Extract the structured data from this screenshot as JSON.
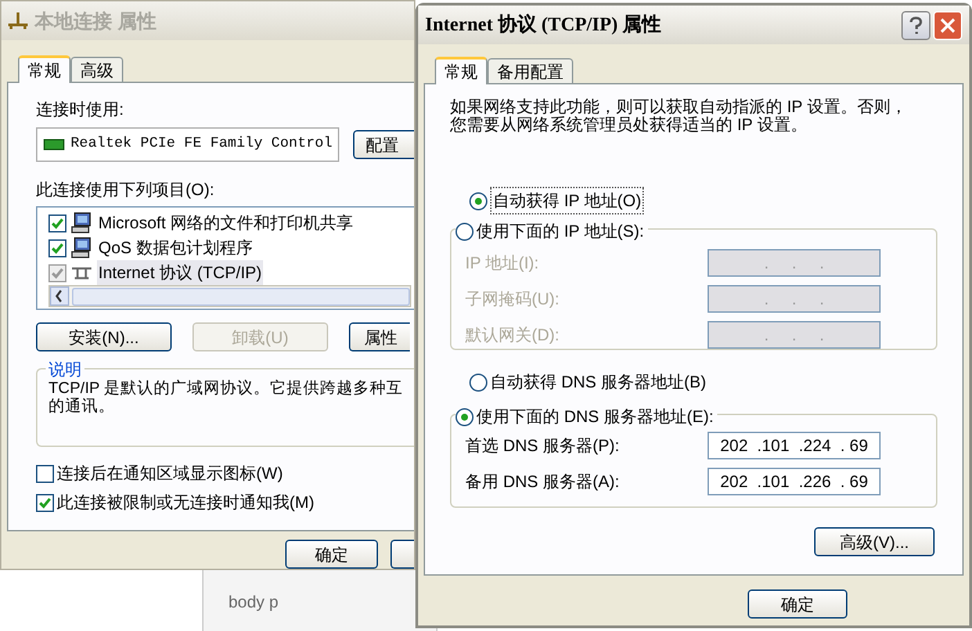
{
  "left_window": {
    "title": "本地连接 属性",
    "tabs": [
      {
        "label": "常规",
        "selected": true
      },
      {
        "label": "高级",
        "selected": false
      }
    ],
    "connect_using_label": "连接时使用:",
    "adapter": "Realtek PCIe FE Family Control",
    "configure_button": "配置",
    "components_label": "此连接使用下列项目(O):",
    "components": [
      {
        "label": "Microsoft 网络的文件和打印机共享",
        "checked": true,
        "selected": false,
        "kind": "computer"
      },
      {
        "label": "QoS 数据包计划程序",
        "checked": true,
        "selected": false,
        "kind": "computer"
      },
      {
        "label": "Internet 协议 (TCP/IP)",
        "checked": true,
        "selected": true,
        "kind": "network"
      }
    ],
    "buttons": [
      {
        "label": "安装(N)...",
        "disabled": false
      },
      {
        "label": "卸载(U)",
        "disabled": true
      },
      {
        "label": "属性",
        "disabled": false
      }
    ],
    "description_title": "说明",
    "description_lines": [
      "TCP/IP 是默认的广域网协议。它提供跨越多种互",
      "的通讯。"
    ],
    "options": [
      {
        "label": "连接后在通知区域显示图标(W)",
        "checked": false
      },
      {
        "label": "此连接被限制或无连接时通知我(M)",
        "checked": true
      }
    ],
    "footer_buttons": [
      "确定"
    ]
  },
  "background_window": {
    "text": "body p"
  },
  "right_window": {
    "title": "Internet 协议 (TCP/IP) 属性",
    "tabs": [
      {
        "label": "常规",
        "selected": true
      },
      {
        "label": "备用配置",
        "selected": false
      }
    ],
    "intro_lines": [
      "如果网络支持此功能，则可以获取自动指派的 IP 设置。否则，",
      "您需要从网络系统管理员处获得适当的 IP 设置。"
    ],
    "ip_options": [
      {
        "label": "自动获得 IP 地址(O)",
        "selected": true
      },
      {
        "label": "使用下面的 IP 地址(S):",
        "selected": false
      }
    ],
    "ip_fields": [
      {
        "label": "IP 地址(I):",
        "disabled": true,
        "value": ".     .     ."
      },
      {
        "label": "子网掩码(U):",
        "disabled": true,
        "value": ".     .     ."
      },
      {
        "label": "默认网关(D):",
        "disabled": true,
        "value": ".     .     ."
      }
    ],
    "dns_options": [
      {
        "label": "自动获得 DNS 服务器地址(B)",
        "selected": false
      },
      {
        "label": "使用下面的 DNS 服务器地址(E):",
        "selected": true
      }
    ],
    "dns_fields": [
      {
        "label": "首选 DNS 服务器(P):",
        "disabled": false,
        "value": "202  .101  .224  . 69"
      },
      {
        "label": "备用 DNS 服务器(A):",
        "disabled": false,
        "value": "202  .101  .226  . 69"
      }
    ],
    "advanced_button": "高级(V)...",
    "footer_buttons": [
      "确定"
    ]
  }
}
